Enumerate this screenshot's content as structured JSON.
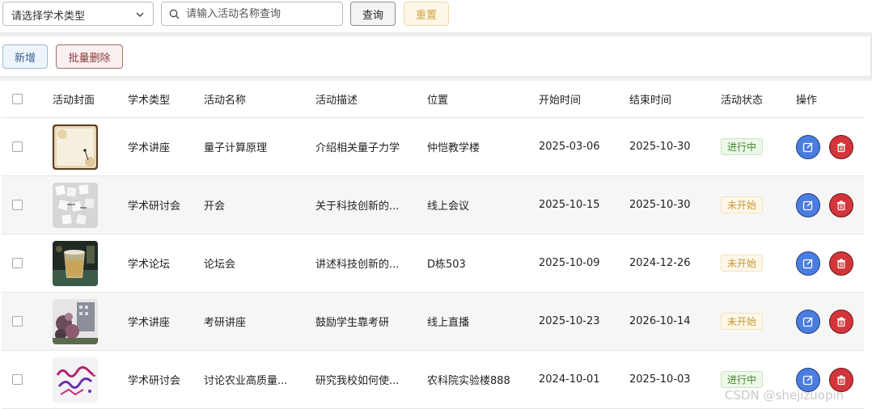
{
  "search": {
    "type_select_value": "请选择学术类型",
    "name_placeholder": "请输入活动名称查询",
    "query_label": "查询",
    "reset_label": "重置"
  },
  "toolbar": {
    "add_label": "新增",
    "batch_delete_label": "批量删除"
  },
  "table": {
    "headers": [
      "活动封面",
      "学术类型",
      "活动名称",
      "活动描述",
      "位置",
      "开始时间",
      "结束时间",
      "活动状态",
      "操作"
    ],
    "rows": [
      {
        "type": "学术讲座",
        "name": "量子计算原理",
        "desc": "介绍相关量子力学",
        "location": "仲恺教学楼",
        "start": "2025-03-06",
        "end": "2025-10-30",
        "status": "进行中",
        "status_kind": "running",
        "cover": "paper-vintage"
      },
      {
        "type": "学术研讨会",
        "name": "开会",
        "desc": "关于科技创新的...",
        "location": "线上会议",
        "start": "2025-10-15",
        "end": "2025-10-30",
        "status": "未开始",
        "status_kind": "pending",
        "cover": "letter-tiles"
      },
      {
        "type": "学术论坛",
        "name": "论坛会",
        "desc": "讲述科技创新的...",
        "location": "D栋503",
        "start": "2025-10-09",
        "end": "2024-12-26",
        "status": "未开始",
        "status_kind": "pending",
        "cover": "drink-glass"
      },
      {
        "type": "学术讲座",
        "name": "考研讲座",
        "desc": "鼓励学生靠考研",
        "location": "线上直播",
        "start": "2025-10-23",
        "end": "2026-10-14",
        "status": "未开始",
        "status_kind": "pending",
        "cover": "flowers-building"
      },
      {
        "type": "学术研讨会",
        "name": "讨论农业高质量...",
        "desc": "研究我校如何使...",
        "location": "农科院实验楼888",
        "start": "2024-10-01",
        "end": "2025-10-03",
        "status": "进行中",
        "status_kind": "running",
        "cover": "calligraphy"
      }
    ]
  },
  "icons": {
    "edit": "edit-icon",
    "delete": "trash-icon",
    "search": "search-icon",
    "select": "chevron-down-icon"
  },
  "colors": {
    "edit_button": "#4b7de0",
    "delete_button": "#d3353a",
    "status_running": "#3f8a2c",
    "status_pending": "#c69a33"
  },
  "watermark": "CSDN @shejizuopin"
}
